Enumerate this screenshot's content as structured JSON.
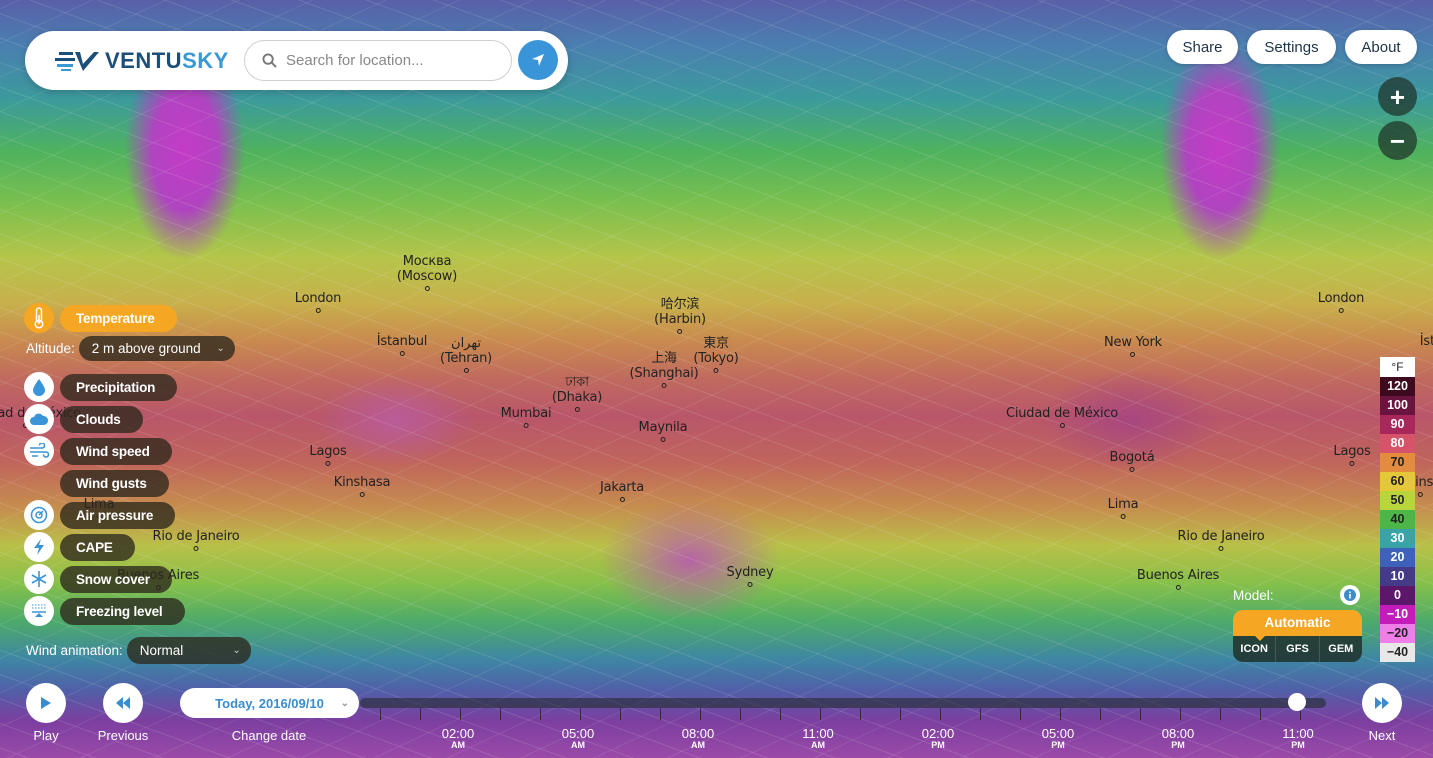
{
  "app": {
    "name": "Ventusky",
    "logo_part1": "VENTU",
    "logo_part2": "SKY"
  },
  "search": {
    "placeholder": "Search for location...",
    "value": ""
  },
  "header_buttons": [
    "Share",
    "Settings",
    "About"
  ],
  "zoom": {
    "in": "+",
    "out": "−"
  },
  "layers": {
    "active": "Temperature",
    "items": [
      {
        "label": "Temperature",
        "icon": "thermometer-icon",
        "active": true
      },
      {
        "label": "Precipitation",
        "icon": "raindrop-icon",
        "active": false
      },
      {
        "label": "Clouds",
        "icon": "cloud-icon",
        "active": false
      },
      {
        "label": "Wind speed",
        "icon": "wind-icon",
        "active": false
      },
      {
        "label": "Wind gusts",
        "icon": null,
        "active": false
      },
      {
        "label": "Air pressure",
        "icon": "pressure-gauge-icon",
        "active": false
      },
      {
        "label": "CAPE",
        "icon": "lightning-icon",
        "active": false
      },
      {
        "label": "Snow cover",
        "icon": "snowflake-icon",
        "active": false
      },
      {
        "label": "Freezing level",
        "icon": "freezing-level-icon",
        "active": false
      }
    ],
    "altitude_label": "Altitude:",
    "altitude_value": "2 m above ground",
    "wind_animation_label": "Wind animation:",
    "wind_animation_value": "Normal"
  },
  "legend": {
    "unit": "°F",
    "entries": [
      {
        "label": "120",
        "color": "#3d0a1e",
        "text": "#fff"
      },
      {
        "label": "100",
        "color": "#6b1440",
        "text": "#fff"
      },
      {
        "label": "90",
        "color": "#a8285c",
        "text": "#fff"
      },
      {
        "label": "80",
        "color": "#d5546a",
        "text": "#fff"
      },
      {
        "label": "70",
        "color": "#e38b3e",
        "text": "#222"
      },
      {
        "label": "60",
        "color": "#e4c83a",
        "text": "#222"
      },
      {
        "label": "50",
        "color": "#b8d63c",
        "text": "#222"
      },
      {
        "label": "40",
        "color": "#4cb648",
        "text": "#222"
      },
      {
        "label": "30",
        "color": "#3aa3a8",
        "text": "#fff"
      },
      {
        "label": "20",
        "color": "#3d62b8",
        "text": "#fff"
      },
      {
        "label": "10",
        "color": "#45398a",
        "text": "#fff"
      },
      {
        "label": "0",
        "color": "#5c176a",
        "text": "#fff"
      },
      {
        "label": "−10",
        "color": "#c21dbb",
        "text": "#fff"
      },
      {
        "label": "−20",
        "color": "#f07ee8",
        "text": "#222"
      },
      {
        "label": "−40",
        "color": "#e8e8e8",
        "text": "#222"
      }
    ]
  },
  "model": {
    "label": "Model:",
    "selected": "Automatic",
    "options": [
      "ICON",
      "GFS",
      "GEM"
    ]
  },
  "timeline": {
    "play_label": "Play",
    "previous_label": "Previous",
    "next_label": "Next",
    "change_date_label": "Change date",
    "date_value": "Today, 2016/09/10",
    "current_time": "11:00 PM",
    "progress": 0.98,
    "labels": [
      {
        "time": "02:00",
        "ampm": "AM"
      },
      {
        "time": "05:00",
        "ampm": "AM"
      },
      {
        "time": "08:00",
        "ampm": "AM"
      },
      {
        "time": "11:00",
        "ampm": "AM"
      },
      {
        "time": "02:00",
        "ampm": "PM"
      },
      {
        "time": "05:00",
        "ampm": "PM"
      },
      {
        "time": "08:00",
        "ampm": "PM"
      },
      {
        "time": "11:00",
        "ampm": "PM"
      }
    ]
  },
  "map": {
    "cities": [
      {
        "name": "Москва",
        "sub": "(Moscow)"
      },
      {
        "name": "London",
        "sub": ""
      },
      {
        "name": "İstanbul",
        "sub": ""
      },
      {
        "name": "تهران",
        "sub": "(Tehran)"
      },
      {
        "name": "哈尔滨",
        "sub": "(Harbin)"
      },
      {
        "name": "東京",
        "sub": "(Tokyo)"
      },
      {
        "name": "上海",
        "sub": "(Shanghai)"
      },
      {
        "name": "ঢাকা",
        "sub": "(Dhaka)"
      },
      {
        "name": "Mumbai",
        "sub": ""
      },
      {
        "name": "Maynila",
        "sub": ""
      },
      {
        "name": "Lagos",
        "sub": ""
      },
      {
        "name": "Kinshasa",
        "sub": ""
      },
      {
        "name": "Jakarta",
        "sub": ""
      },
      {
        "name": "Sydney",
        "sub": ""
      },
      {
        "name": "New York",
        "sub": ""
      },
      {
        "name": "Ciudad de México",
        "sub": ""
      },
      {
        "name": "Bogotá",
        "sub": ""
      },
      {
        "name": "Lima",
        "sub": ""
      },
      {
        "name": "Rio de Janeiro",
        "sub": ""
      },
      {
        "name": "Buenos Aires",
        "sub": ""
      },
      {
        "name": "London",
        "sub": ""
      },
      {
        "name": "Lagos",
        "sub": ""
      },
      {
        "name": "Rio de Janeiro",
        "sub": ""
      },
      {
        "name": "Buenos Aires",
        "sub": ""
      },
      {
        "name": "Lima",
        "sub": ""
      },
      {
        "name": "Kins",
        "sub": ""
      },
      {
        "name": "İstanbul",
        "sub": ""
      },
      {
        "name": "Ciudad de México",
        "sub": ""
      },
      {
        "name": "Lagos",
        "sub": ""
      }
    ]
  }
}
